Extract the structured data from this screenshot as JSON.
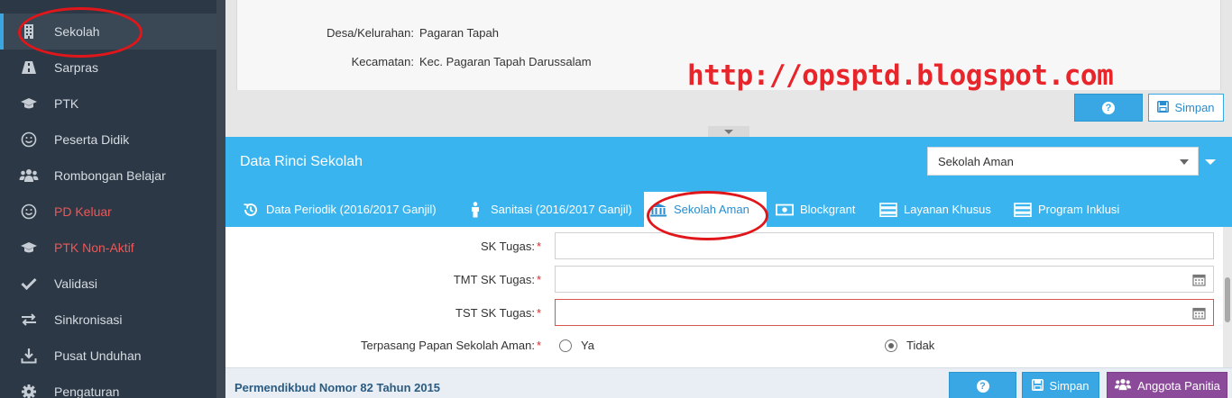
{
  "sidebar": {
    "items": [
      {
        "label": "Sekolah",
        "icon": "building-icon",
        "active": true
      },
      {
        "label": "Sarpras",
        "icon": "road-icon"
      },
      {
        "label": "PTK",
        "icon": "graduation-cap-icon"
      },
      {
        "label": "Peserta Didik",
        "icon": "smile-icon"
      },
      {
        "label": "Rombongan Belajar",
        "icon": "group-icon"
      },
      {
        "label": "PD Keluar",
        "icon": "smile-icon",
        "highlight": "#f05656"
      },
      {
        "label": "PTK Non-Aktif",
        "icon": "graduation-cap-icon",
        "highlight": "#f05656"
      },
      {
        "label": "Validasi",
        "icon": "check-icon"
      },
      {
        "label": "Sinkronisasi",
        "icon": "exchange-icon"
      },
      {
        "label": "Pusat Unduhan",
        "icon": "download-icon"
      },
      {
        "label": "Pengaturan",
        "icon": "gear-icon"
      }
    ]
  },
  "upper": {
    "fields": [
      {
        "label": "Desa/Kelurahan:",
        "value": "Pagaran Tapah"
      },
      {
        "label": "Kecamatan:",
        "value": "Kec. Pagaran Tapah Darussalam"
      }
    ],
    "help_icon": "question-icon",
    "save_label": "Simpan"
  },
  "watermark": "http://opsptd.blogspot.com",
  "panel": {
    "title": "Data Rinci Sekolah",
    "select_value": "Sekolah Aman",
    "tabs": [
      {
        "label": "Data Periodik (2016/2017 Ganjil)",
        "icon": "history-icon"
      },
      {
        "label": "Sanitasi (2016/2017 Ganjil)",
        "icon": "person-icon"
      },
      {
        "label": "Sekolah Aman",
        "icon": "bank-icon",
        "active": true
      },
      {
        "label": "Blockgrant",
        "icon": "money-icon"
      },
      {
        "label": "Layanan Khusus",
        "icon": "server-icon"
      },
      {
        "label": "Program Inklusi",
        "icon": "server-icon"
      }
    ]
  },
  "form": {
    "sk_tugas": {
      "label": "SK Tugas:",
      "value": ""
    },
    "tmt_sk_tugas": {
      "label": "TMT SK Tugas:",
      "value": ""
    },
    "tst_sk_tugas": {
      "label": "TST SK Tugas:",
      "value": ""
    },
    "papan": {
      "label": "Terpasang Papan Sekolah Aman:",
      "options": [
        "Ya",
        "Tidak"
      ],
      "selected": "Tidak"
    },
    "required_mark": "*"
  },
  "footer": {
    "text": "Permendikbud Nomor 82 Tahun 2015",
    "save_label": "Simpan",
    "members_label": "Anggota Panitia"
  },
  "colors": {
    "sidebar_bg": "#2c3845",
    "accent": "#3ab4ee",
    "danger": "#f05656",
    "annotation": "#e0161b",
    "purple": "#8c4a9a"
  }
}
